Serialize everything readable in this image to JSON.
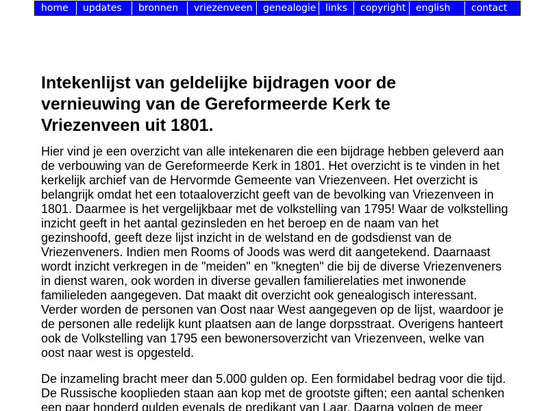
{
  "nav": {
    "items": [
      {
        "id": "home",
        "label": "home"
      },
      {
        "id": "updates",
        "label": "updates"
      },
      {
        "id": "bronnen",
        "label": "bronnen"
      },
      {
        "id": "vriezenveen",
        "label": "vriezenveen"
      },
      {
        "id": "genealogie",
        "label": "genealogie"
      },
      {
        "id": "links",
        "label": "links"
      },
      {
        "id": "copyright",
        "label": "copyright"
      },
      {
        "id": "english",
        "label": "english"
      },
      {
        "id": "contact",
        "label": "contact"
      }
    ],
    "background": "#0000ff",
    "text_color": "#ffffff"
  },
  "main": {
    "title": "Intekenlijst van geldelijke bijdragen voor de vernieuwing van de Gereformeerde Kerk te Vriezenveen uit 1801.",
    "paragraphs": [
      "Hier vind je een overzicht van alle intekenaren die een bijdrage hebben geleverd aan de verbouwing van de Gereformeerde Kerk in 1801. Het overzicht is te vinden in het kerkelijk archief van de Hervormde Gemeente van Vriezenveen. Het overzicht is belangrijk omdat het een totaaloverzicht geeft van de bevolking van Vriezenveen in 1801. Daarmee is het vergelijkbaar met de volkstelling van 1795! Waar de volkstelling inzicht geeft in het aantal gezinsleden en het beroep en de naam van het gezinshoofd, geeft deze lijst inzicht in de welstand en de godsdienst van de Vriezenveners. Indien men Rooms of Joods was werd dit aangetekend. Daarnaast wordt inzicht verkregen in de \"meiden\" en \"knegten\" die bij de diverse Vriezenveners in dienst waren, ook worden in diverse gevallen familierelaties met inwonende familieleden aangegeven. Dat maakt dit overzicht ook genealogisch interessant. Verder worden de personen van Oost naar West aangegeven op de lijst, waardoor je de personen alle redelijk kunt plaatsen aan de lange dorpsstraat. Overigens hanteert ook de Volkstelling van 1795 een bewonersoverzicht van Vriezenveen, welke van oost naar west is opgesteld.",
      "De inzameling bracht meer dan 5.000 gulden op. Een formidabel bedrag voor die tijd. De Russische kooplieden staan aan kop met de grootste giften; een aantal schenken een paar honderd gulden evenals de predikant van Laar. Daarna volgen de meer"
    ]
  }
}
